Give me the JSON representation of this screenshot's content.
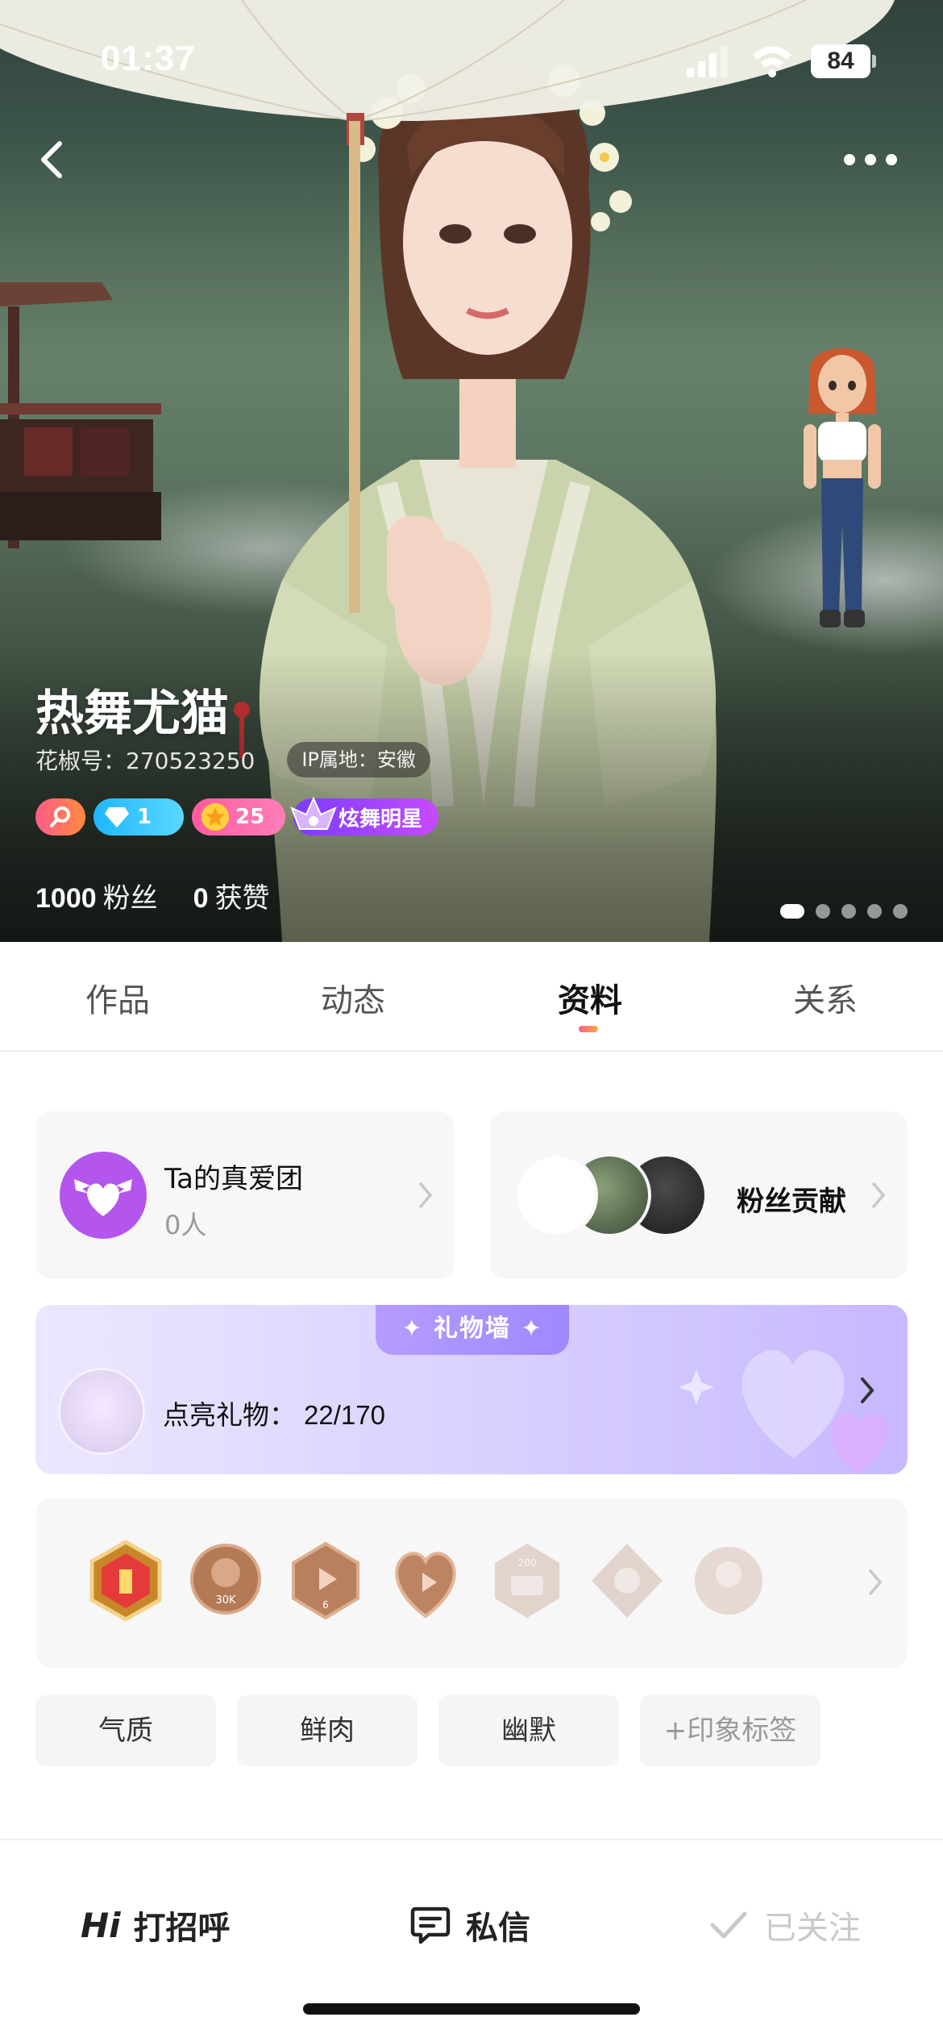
{
  "status_bar": {
    "time": "01:37",
    "battery": "84"
  },
  "profile": {
    "name": "热舞尤猫",
    "uid": "花椒号：270523250",
    "ip": "IP属地：安徽",
    "badges": {
      "diamond_level": "1",
      "star_level": "25",
      "title": "炫舞明星"
    },
    "stats": {
      "fans_count": "1000",
      "fans_label": "粉丝",
      "likes_count": "0",
      "likes_label": "获赞"
    }
  },
  "tabs": [
    {
      "label": "作品"
    },
    {
      "label": "动态"
    },
    {
      "label": "资料",
      "active": true
    },
    {
      "label": "关系"
    }
  ],
  "fans_club": {
    "title": "Ta的真爱团",
    "count": "0人"
  },
  "contribution": {
    "label": "粉丝贡献"
  },
  "gift_wall": {
    "tag": "礼物墙",
    "label": "点亮礼物：",
    "count": "22/170"
  },
  "impression_tags": [
    "气质",
    "鲜肉",
    "幽默",
    "+印象标签"
  ],
  "bottom_actions": {
    "greet_hi": "Hi",
    "greet": "打招呼",
    "message": "私信",
    "followed": "已关注"
  },
  "colors": {
    "accent_purple": "#b455ee",
    "tab_indicator": "#ff5b8a",
    "gift_wall_bg": "#dcd3ff"
  }
}
